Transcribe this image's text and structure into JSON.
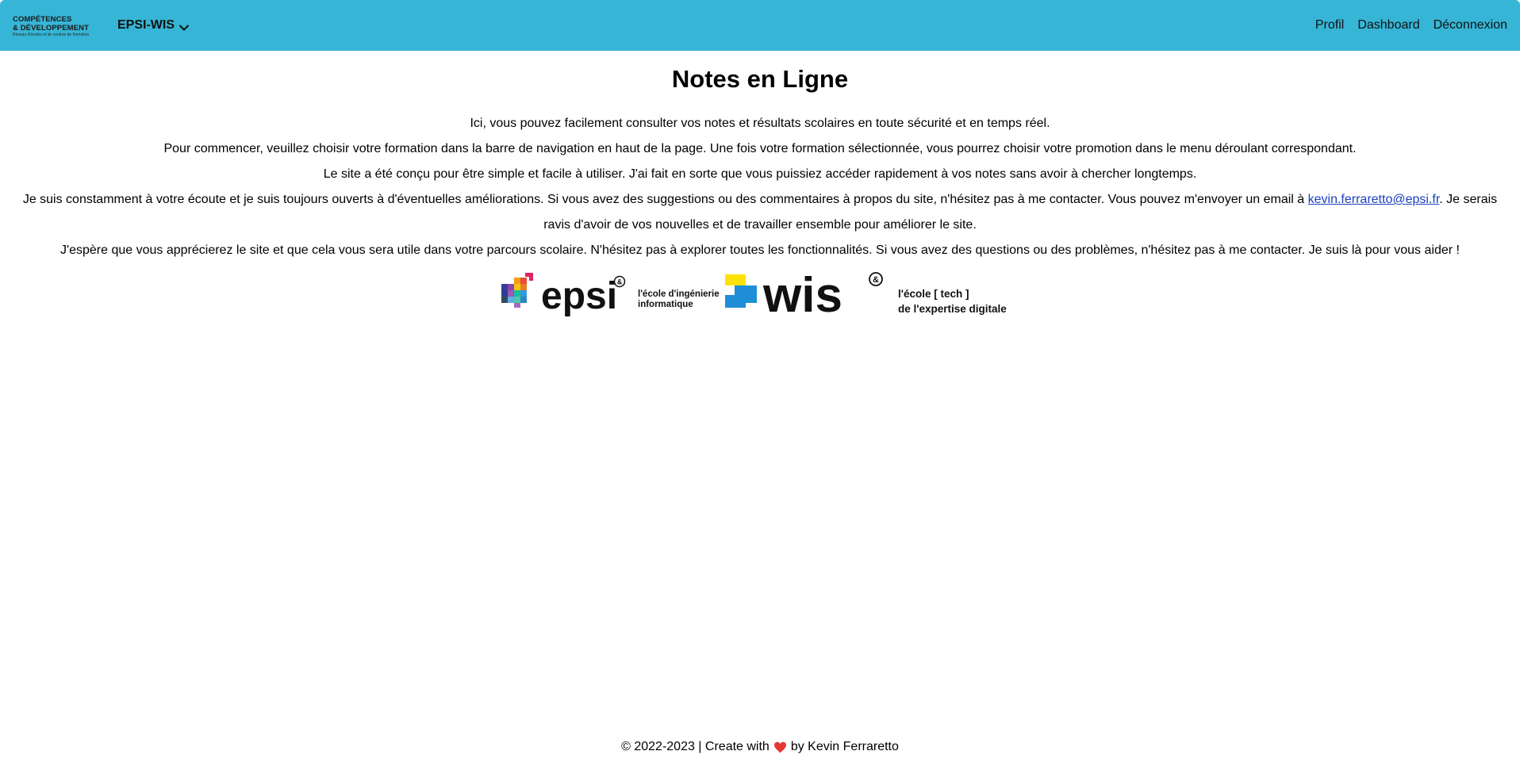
{
  "navbar": {
    "brand": {
      "line1": "COMPÉTENCES",
      "line2": "& DÉVELOPPEMENT",
      "line3": "Réseau d'écoles et de centres de formation"
    },
    "dropdown_label": "EPSI-WIS",
    "links": [
      "Profil",
      "Dashboard",
      "Déconnexion"
    ]
  },
  "main": {
    "title": "Notes en Ligne",
    "paragraphs": {
      "p1": "Ici, vous pouvez facilement consulter vos notes et résultats scolaires en toute sécurité et en temps réel.",
      "p2": "Pour commencer, veuillez choisir votre formation dans la barre de navigation en haut de la page. Une fois votre formation sélectionnée, vous pourrez choisir votre promotion dans le menu déroulant correspondant.",
      "p3": "Le site a été conçu pour être simple et facile à utiliser. J'ai fait en sorte que vous puissiez accéder rapidement à vos notes sans avoir à chercher longtemps.",
      "p4_before": "Je suis constamment à votre écoute et je suis toujours ouverts à d'éventuelles améliorations. Si vous avez des suggestions ou des commentaires à propos du site, n'hésitez pas à me contacter. Vous pouvez m'envoyer un email à ",
      "p4_email": "kevin.ferraretto@epsi.fr",
      "p4_after": ". Je serais ravis d'avoir de vos nouvelles et de travailler ensemble pour améliorer le site.",
      "p5": "J'espère que vous apprécierez le site et que cela vous sera utile dans votre parcours scolaire. N'hésitez pas à explorer toutes les fonctionnalités. Si vous avez des questions ou des problèmes, n'hésitez pas à me contacter. Je suis là pour vous aider !"
    },
    "logos": {
      "epsi_name": "epsi",
      "epsi_tagline_1": "l'école d'ingénierie",
      "epsi_tagline_2": "informatique",
      "wis_name": "wis",
      "wis_tagline_1": "l'école [ tech ]",
      "wis_tagline_2": "de l'expertise digitale",
      "registered_mark": "&"
    }
  },
  "footer": {
    "before": "© 2022-2023 | Create with",
    "after": "by Kevin Ferraretto"
  },
  "colors": {
    "navbar_bg": "#36b5d6",
    "link": "#1a3fbf",
    "heart": "#e53935"
  }
}
